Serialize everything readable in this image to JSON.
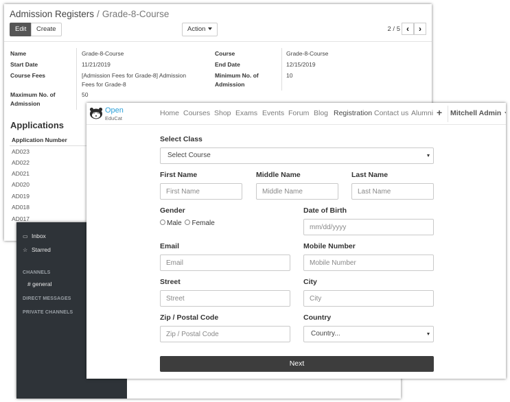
{
  "backend": {
    "breadcrumb_parent": "Admission Registers",
    "breadcrumb_sep": "/",
    "breadcrumb_current": "Grade-8-Course",
    "edit_label": "Edit",
    "create_label": "Create",
    "action_label": "Action",
    "pager": "2 / 5",
    "fields_left": [
      {
        "label": "Name",
        "value": "Grade-8-Course"
      },
      {
        "label": "Start Date",
        "value": "11/21/2019"
      },
      {
        "label": "Course Fees",
        "value": "[Admission Fees for Grade-8] Admission Fees for Grade-8"
      },
      {
        "label": "Maximum No. of Admission",
        "value": "50"
      }
    ],
    "fields_right": [
      {
        "label": "Course",
        "value": "Grade-8-Course"
      },
      {
        "label": "End Date",
        "value": "12/15/2019"
      },
      {
        "label": "Minimum No. of Admission",
        "value": "10"
      }
    ],
    "applications_title": "Applications",
    "applications_header": "Application Number",
    "applications": [
      "AD023",
      "AD022",
      "AD021",
      "AD020",
      "AD019",
      "AD018",
      "AD017"
    ]
  },
  "discuss": {
    "inbox": "Inbox",
    "starred": "Starred",
    "channels_caption": "CHANNELS",
    "general": "# general",
    "direct_caption": "DIRECT MESSAGES",
    "private_caption": "PRIVATE CHANNELS"
  },
  "website": {
    "brand_top": "Open",
    "brand_bottom": "EduCat",
    "nav": [
      "Home",
      "Courses",
      "Shop",
      "Exams",
      "Events",
      "Forum",
      "Blog",
      "Registration",
      "Contact us",
      "Alumni"
    ],
    "active_nav": "Registration",
    "user": "Mitchell Admin",
    "form": {
      "select_class_label": "Select Class",
      "select_class_value": "Select Course",
      "first_name_label": "First Name",
      "first_name_placeholder": "First Name",
      "middle_name_label": "Middle Name",
      "middle_name_placeholder": "Middle Name",
      "last_name_label": "Last Name",
      "last_name_placeholder": "Last Name",
      "gender_label": "Gender",
      "gender_male": "Male",
      "gender_female": "Female",
      "dob_label": "Date of Birth",
      "dob_placeholder": "mm/dd/yyyy",
      "email_label": "Email",
      "email_placeholder": "Email",
      "mobile_label": "Mobile Number",
      "mobile_placeholder": "Mobile Number",
      "street_label": "Street",
      "street_placeholder": "Street",
      "city_label": "City",
      "city_placeholder": "City",
      "zip_label": "Zip / Postal Code",
      "zip_placeholder": "Zip / Postal Code",
      "country_label": "Country",
      "country_value": "Country...",
      "next_label": "Next"
    }
  },
  "colors": {
    "brand_blue": "#2a9fd8",
    "dark_sidebar": "#2e3338",
    "next_button": "#3d3d3d"
  }
}
